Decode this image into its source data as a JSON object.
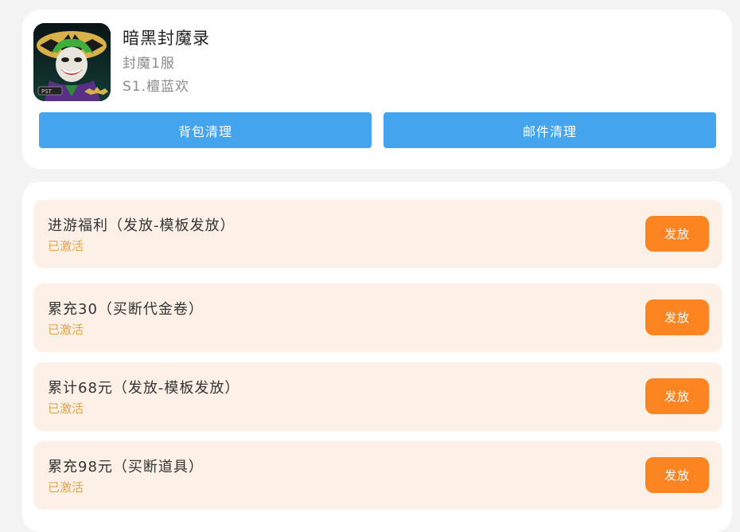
{
  "game": {
    "title": "暗黑封魔录",
    "server": "封魔1服",
    "role": "S1.檀蓝欢",
    "icon": "joker-game-icon"
  },
  "actions": {
    "bag_clean": "背包清理",
    "mail_clean": "邮件清理"
  },
  "benefits": [
    {
      "name": "进游福利（发放-模板发放）",
      "status": "已激活",
      "button": "发放"
    },
    {
      "name": "累充30（买断代金卷）",
      "status": "已激活",
      "button": "发放"
    },
    {
      "name": "累计68元（发放-模板发放）",
      "status": "已激活",
      "button": "发放"
    },
    {
      "name": "累充98元（买断道具）",
      "status": "已激活",
      "button": "发放"
    }
  ],
  "colors": {
    "primary_blue": "#44a4ee",
    "grant_orange": "#fc8522",
    "row_background": "#fdf1e7",
    "status_text": "#e2a44a"
  }
}
